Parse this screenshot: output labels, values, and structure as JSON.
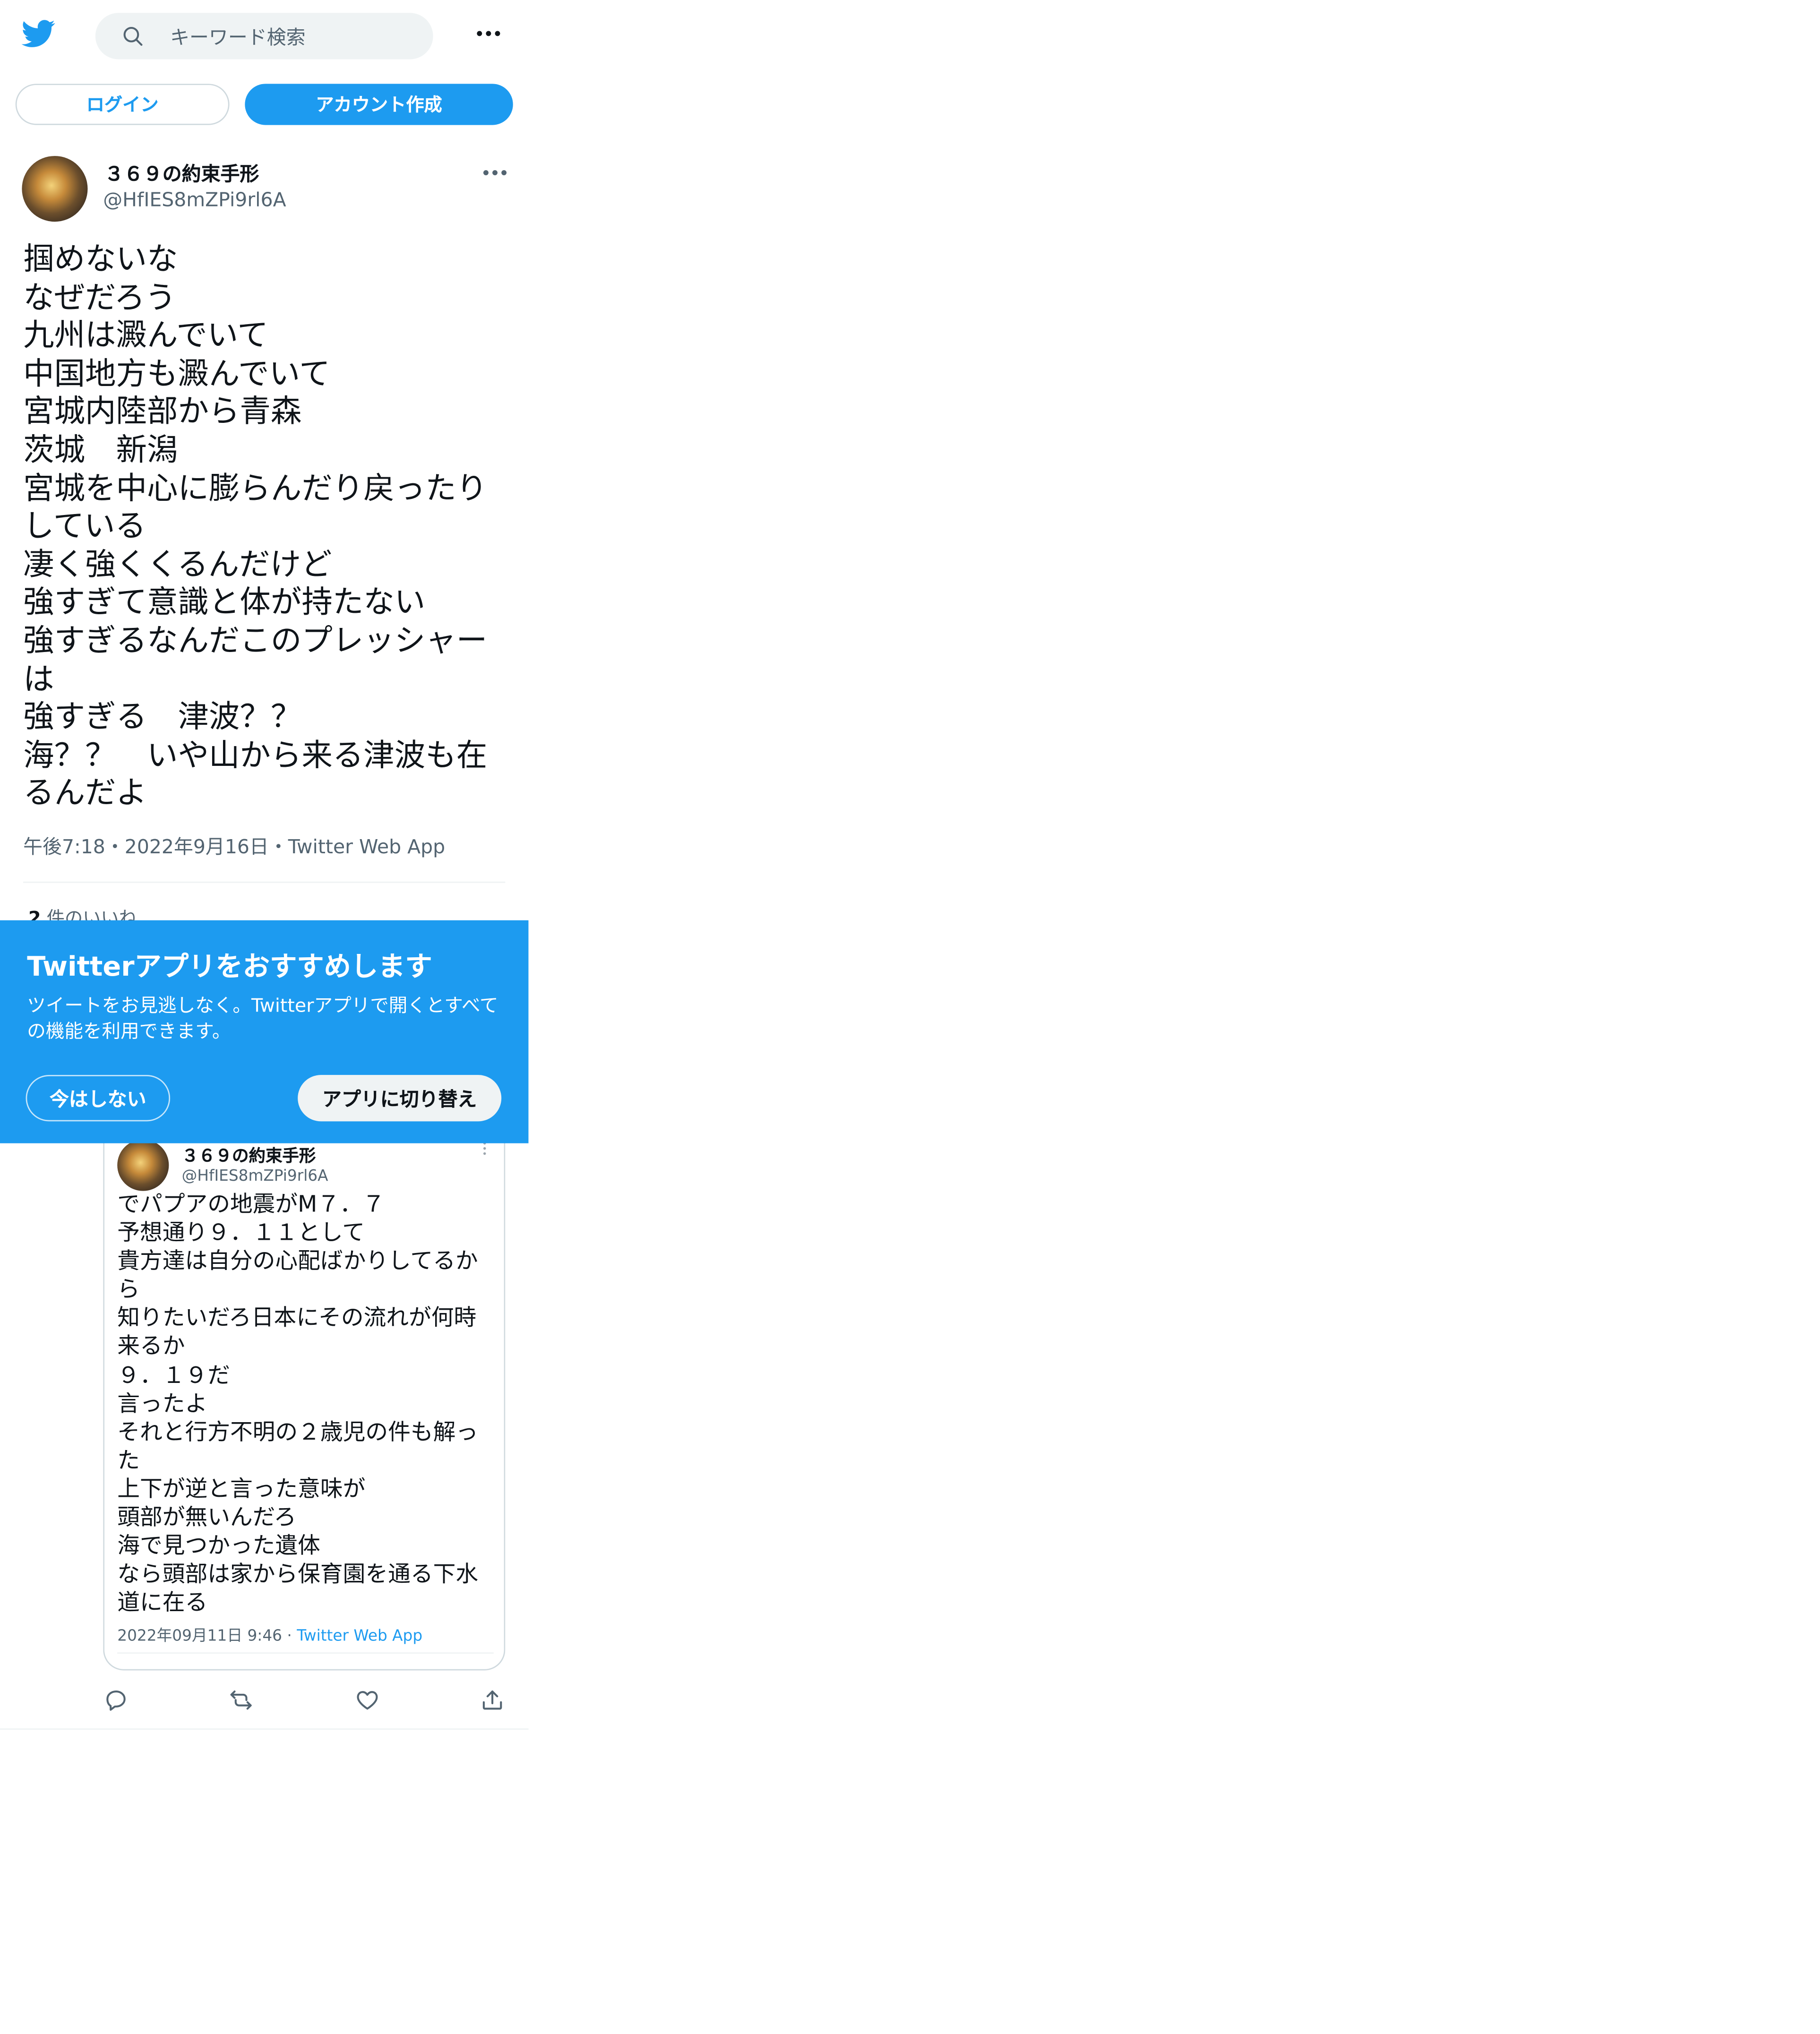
{
  "header": {
    "logo": "twitter-bird-icon",
    "search_placeholder": "キーワード検索",
    "more": "more-icon"
  },
  "auth": {
    "login_label": "ログイン",
    "signup_label": "アカウント作成"
  },
  "tweet": {
    "author_name": "３６９の約束手形",
    "author_handle": "@HfIES8mZPi9rl6A",
    "lines": [
      "掴めないな",
      "なぜだろう",
      "九州は澱んでいて",
      "中国地方も澱んでいて",
      "宮城内陸部から青森",
      "茨城　新潟",
      "宮城を中心に膨らんだり戻ったり",
      "している",
      "凄く強くくるんだけど",
      "強すぎて意識と体が持たない",
      "強すぎるなんだこのプレッシャー",
      "は",
      "強すぎる　津波？？",
      "海？？　いや山から来る津波も在",
      "るんだよ"
    ],
    "time": "午後7:18",
    "date": "2022年9月16日",
    "source": "Twitter Web App",
    "separator": "・",
    "likes_count": "2",
    "likes_label": "件のいいね"
  },
  "app_banner": {
    "title": "Twitterアプリをおすすめします",
    "body": "ツイートをお見逃しなく。Twitterアプリで開くとすべての機能を利用できます。",
    "not_now_label": "今はしない",
    "switch_label": "アプリに切り替え",
    "color": "#1d9bf0"
  },
  "embedded_card": {
    "author_name": "３６９の約束手形",
    "author_handle": "@HfIES8mZPi9rl6A",
    "lines": [
      "でパプアの地震がM７．７",
      "予想通り９．１１として",
      "貴方達は自分の心配ばかりしてるか",
      "ら",
      "知りたいだろ日本にその流れが何時",
      "来るか",
      "９．１９だ",
      "言ったよ",
      "それと行方不明の２歳児の件も解っ",
      "た",
      "上下が逆と言った意味が",
      "頭部が無いんだろ",
      "海で見つかった遺体",
      "なら頭部は家から保育園を通る下水",
      "道に在る"
    ],
    "timestamp": "2022年09月11日 9:46",
    "separator": " · ",
    "source": "Twitter Web App"
  },
  "actions": [
    "reply-icon",
    "retweet-icon",
    "like-icon",
    "share-icon"
  ],
  "colors": {
    "accent": "#1d9bf0",
    "text": "#0f1419",
    "secondary": "#536471"
  }
}
